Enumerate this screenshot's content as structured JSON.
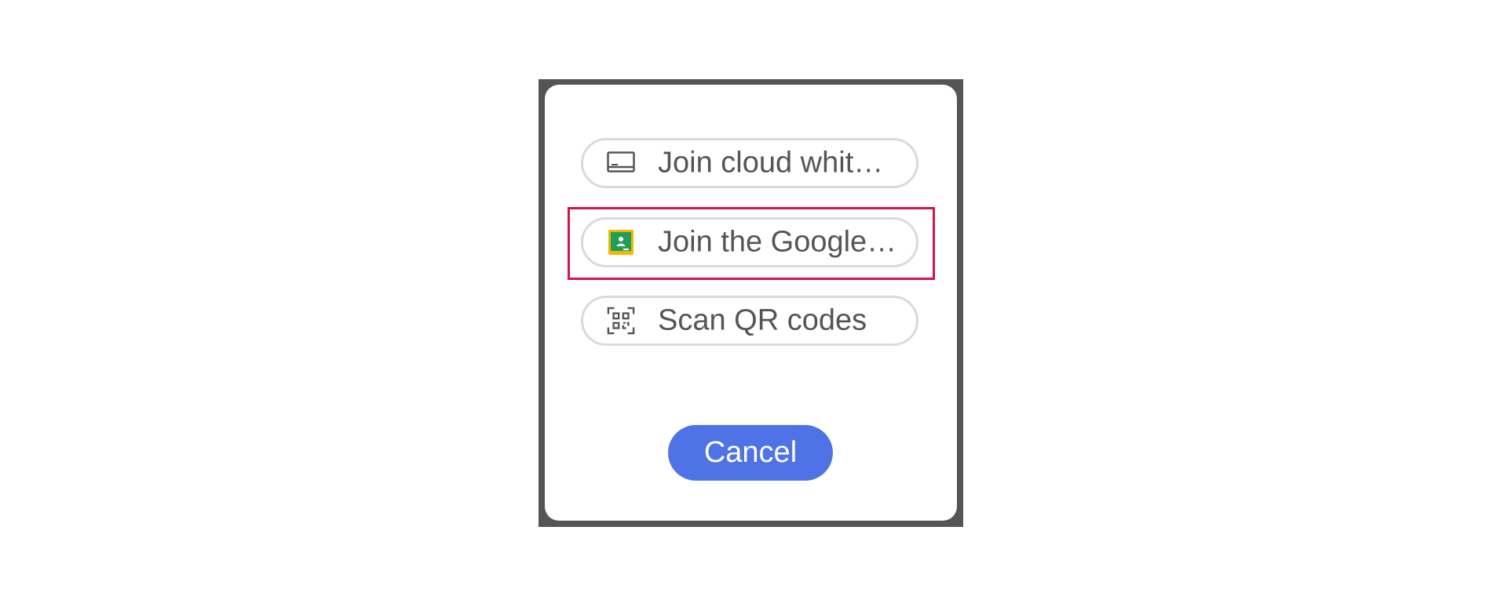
{
  "dialog": {
    "options": [
      {
        "id": "cloud",
        "label": "Join cloud whit…",
        "icon": "whiteboard-icon"
      },
      {
        "id": "classroom",
        "label": "Join the Google…",
        "icon": "google-classroom-icon"
      },
      {
        "id": "qr",
        "label": "Scan QR codes",
        "icon": "qr-code-icon"
      }
    ],
    "cancel_label": "Cancel"
  },
  "colors": {
    "frame": "#555555",
    "option_border": "#dadada",
    "text": "#555555",
    "highlight": "#d6124a",
    "cancel_bg": "#4f73e6",
    "classroom_green": "#1e9e58",
    "classroom_yellow": "#f7b500"
  }
}
